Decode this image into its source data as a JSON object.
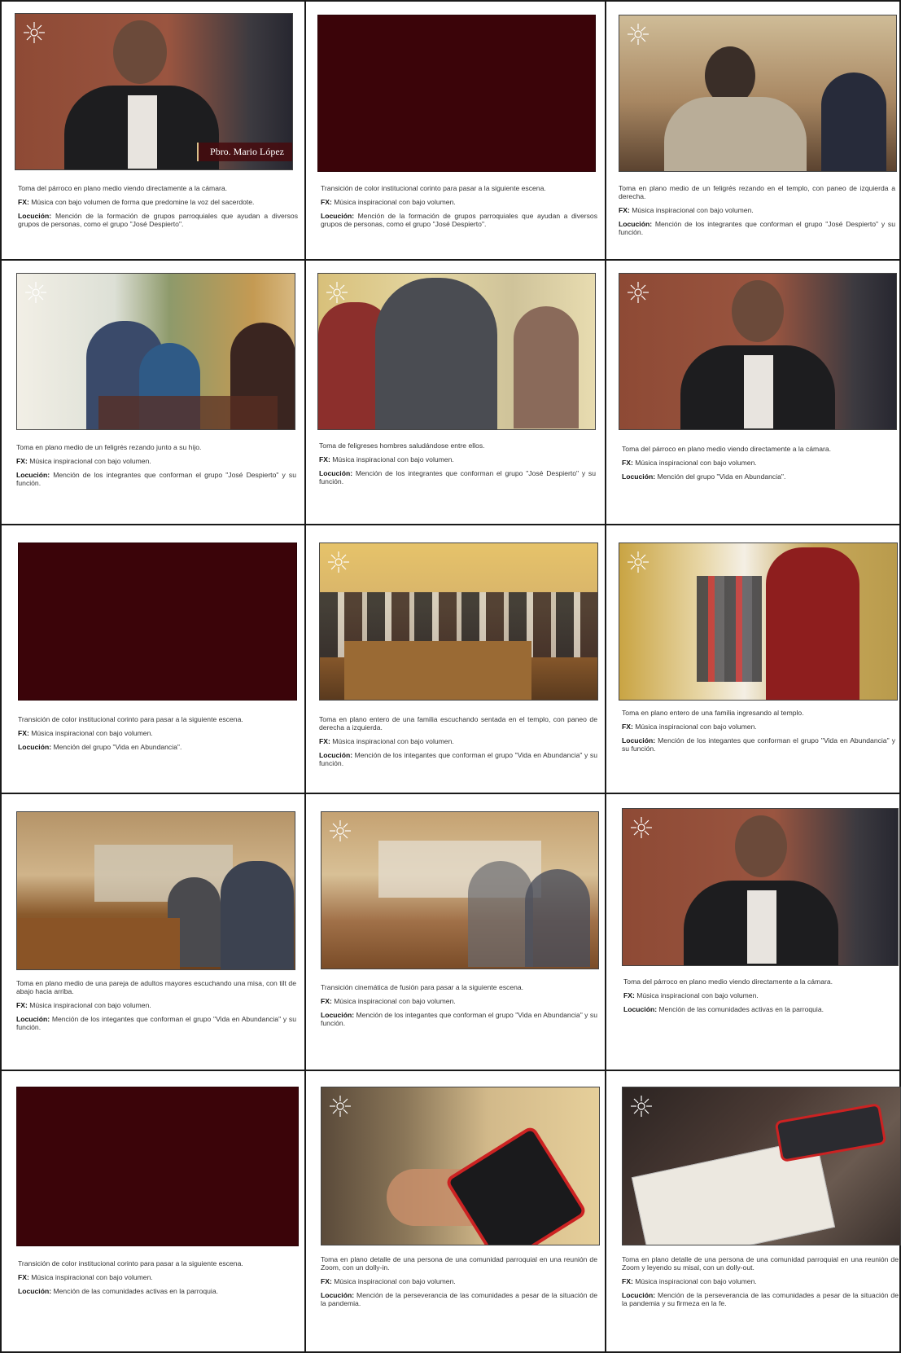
{
  "colors": {
    "corinto": "#3b0409",
    "grid_line": "#1a1a1a"
  },
  "fx_label": "FX:",
  "locucion_label": "Locución:",
  "logo_icon": "parish-logo-icon",
  "cells": [
    {
      "frame": "Pbro. Mario López",
      "desc": "Toma del párroco en plano medio viendo directamente a la cámara.",
      "fx": "Música con bajo volumen de forma que predomine la voz del sacerdote.",
      "loc": "Mención de la formación de grupos parroquiales que ayudan a diversos grupos de personas, como el grupo \"José Despierto\"."
    },
    {
      "desc": "Transición de color institucional corinto para pasar a la siguiente escena.",
      "fx": "Música inspiracional con bajo volumen.",
      "loc": "Mención de la formación de grupos parroquiales que ayudan a diversos grupos de personas, como el grupo \"José Despierto\"."
    },
    {
      "desc": "Toma en plano medio de un feligrés rezando en el templo, con paneo de izquierda a derecha.",
      "fx": "Música inspiracional con bajo volumen.",
      "loc": "Mención de los integrantes que conforman el grupo \"José Despierto\" y su función."
    },
    {
      "desc": "Toma en plano medio de un feligrés rezando junto a su hijo.",
      "fx": "Música inspiracional con bajo volumen.",
      "loc": "Mención de los integrantes que conforman el grupo \"José Despierto\" y su función."
    },
    {
      "desc": "Toma de feligreses hombres saludándose entre ellos.",
      "fx": "Música inspiracional con bajo volumen.",
      "loc": "Mención de los integrantes que conforman el grupo \"José Despierto\" y su función."
    },
    {
      "desc": "Toma del párroco en plano medio viendo directamente a la cámara.",
      "fx": "Música inspiracional con bajo volumen.",
      "loc": "Mención del grupo \"Vida en Abundancia\"."
    },
    {
      "desc": "Transición de color institucional corinto para pasar a la siguiente escena.",
      "fx": "Música inspiracional con bajo volumen.",
      "loc": "Mención del grupo \"Vida en Abundancia\"."
    },
    {
      "desc": "Toma en plano entero de una familia escuchando sentada en el templo, con paneo de derecha a izquierda.",
      "fx": "Música inspiracional con bajo volumen.",
      "loc": "Mención de los integantes que conforman el grupo \"Vida en Abundancia\" y su función."
    },
    {
      "desc": "Toma en plano entero de una familia ingresando al templo.",
      "fx": "Música inspiracional con bajo volumen.",
      "loc": "Mención de los integantes que conforman el grupo \"Vida en Abundancia\" y su función."
    },
    {
      "desc": "Toma en plano medio de una pareja de adultos mayores escuchando una misa, con tilt de abajo hacia arriba.",
      "fx": "Música inspiracional con bajo volumen.",
      "loc": "Mención de los integantes que conforman el grupo \"Vida en Abundancia\" y su función."
    },
    {
      "desc": "Transición cinemática de fusión para pasar a la siguiente escena.",
      "fx": "Música inspiracional con bajo volumen.",
      "loc": "Mención de los integantes que conforman el grupo \"Vida en Abundancia\" y su función."
    },
    {
      "desc": "Toma del párroco en plano medio viendo directamente a la cámara.",
      "fx": "Música inspiracional con bajo volumen.",
      "loc": "Mención de las comunidades activas en la parroquia."
    },
    {
      "desc": "Transición de color institucional corinto para pasar a la siguiente escena.",
      "fx": "Música inspiracional con bajo volumen.",
      "loc": "Mención de las comunidades activas en la parroquia."
    },
    {
      "desc": "Toma en plano detalle de una persona de una comunidad parroquial en una reunión de Zoom, con un dolly-in.",
      "fx": "Música inspiracional con bajo volumen.",
      "loc": "Mención de la perseverancia de las comunidades a pesar de la situación de la pandemia."
    },
    {
      "desc": "Toma en plano detalle de una persona de una comunidad parroquial en una reunión de Zoom y leyendo su misal, con un dolly-out.",
      "fx": "Música inspiracional con bajo volumen.",
      "loc": "Mención de la perseverancia de las comunidades a pesar de la situación de la pandemia y su firmeza en la fe."
    }
  ]
}
